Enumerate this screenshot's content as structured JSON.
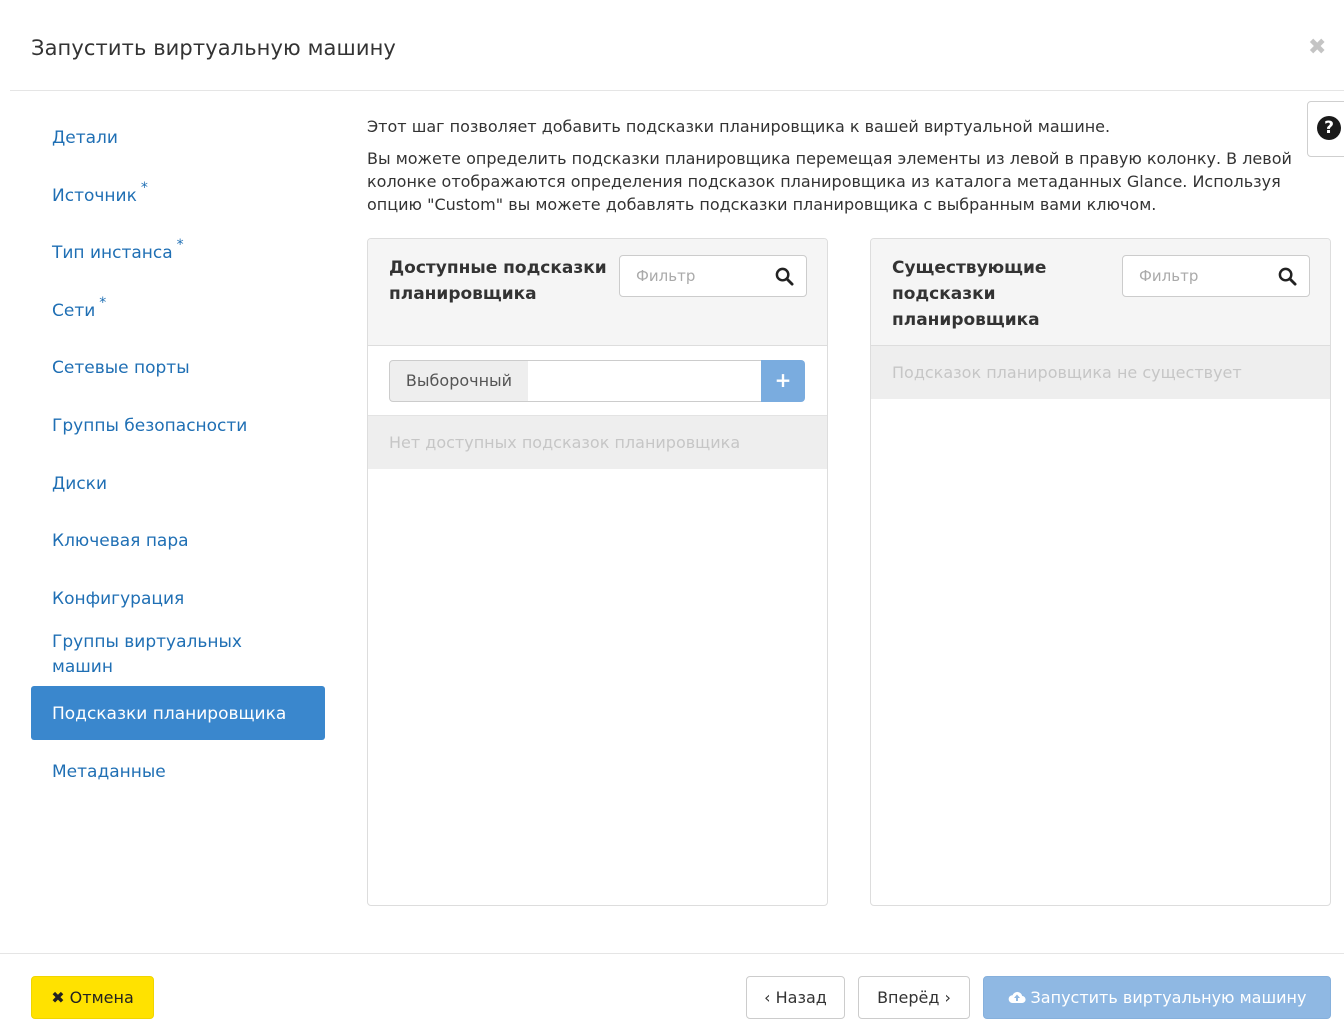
{
  "modal": {
    "title": "Запустить виртуальную машину",
    "close_glyph": "✖"
  },
  "nav": {
    "required_marker": "*",
    "items": [
      {
        "label": "Детали"
      },
      {
        "label": "Источник"
      },
      {
        "label": "Тип инстанса"
      },
      {
        "label": "Сети"
      },
      {
        "label": "Сетевые порты"
      },
      {
        "label": "Группы безопасности"
      },
      {
        "label": "Диски"
      },
      {
        "label": "Ключевая пара"
      },
      {
        "label": "Конфигурация"
      },
      {
        "label": "Группы виртуальных машин"
      },
      {
        "label": "Подсказки планировщика"
      },
      {
        "label": "Метаданные"
      }
    ]
  },
  "help": {
    "glyph": "?"
  },
  "description": {
    "line1": "Этот шаг позволяет добавить подсказки планировщика к вашей виртуальной машине.",
    "line2": "Вы можете определить подсказки планировщика перемещая элементы из левой в правую колонку. В левой колонке отображаются определения подсказок планировщика из каталога метаданных Glance. Используя опцию \"Custom\" вы можете добавлять подсказки планировщика с выбранным вами ключом."
  },
  "available": {
    "title": "Доступные подсказки планировщика",
    "filter_placeholder": "Фильтр",
    "custom_label": "Выборочный",
    "custom_value": "",
    "add_glyph": "+",
    "empty_text": "Нет доступных подсказок планировщика"
  },
  "existing": {
    "title": "Существующие подсказки планировщика",
    "filter_placeholder": "Фильтр",
    "empty_text": "Подсказок планировщика не существует"
  },
  "footer": {
    "cancel": "Отмена",
    "cancel_glyph": "✖",
    "back": "‹ Назад",
    "next": "Вперёд ›",
    "launch": "Запустить виртуальную машину"
  },
  "colors": {
    "accent": "#3a87cd",
    "link": "#1f6fb4",
    "cancel": "#ffe200",
    "launch_disabled": "#8fb8e3"
  }
}
